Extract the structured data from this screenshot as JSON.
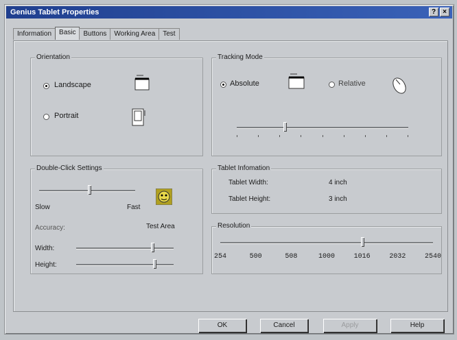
{
  "window": {
    "title": "Genius Tablet Properties",
    "help_btn": "?",
    "close_btn": "×"
  },
  "tabs": [
    "Information",
    "Basic",
    "Buttons",
    "Working Area",
    "Test"
  ],
  "orientation": {
    "label": "Orientation",
    "landscape": "Landscape",
    "portrait": "Portrait",
    "selected": "Landscape"
  },
  "tracking": {
    "label": "Tracking Mode",
    "absolute": "Absolute",
    "relative": "Relative",
    "selected": "Absolute",
    "speed_level": 0.28
  },
  "double_click": {
    "label": "Double-Click Settings",
    "slow": "Slow",
    "fast": "Fast",
    "speed_level": 0.52,
    "accuracy_label": "Accuracy:",
    "test_area": "Test Area",
    "width_label": "Width:",
    "height_label": "Height:",
    "width_level": 0.78,
    "height_level": 0.8
  },
  "tablet_info": {
    "label": "Tablet Infomation",
    "width_label": "Tablet Width:",
    "width_value": "4 inch",
    "height_label": "Tablet Height:",
    "height_value": "3 inch"
  },
  "resolution": {
    "label": "Resolution",
    "values": [
      "254",
      "500",
      "508",
      "1000",
      "1016",
      "2032",
      "2540"
    ],
    "selected": "1016"
  },
  "buttons": {
    "ok": "OK",
    "cancel": "Cancel",
    "apply": "Apply",
    "help": "Help"
  }
}
